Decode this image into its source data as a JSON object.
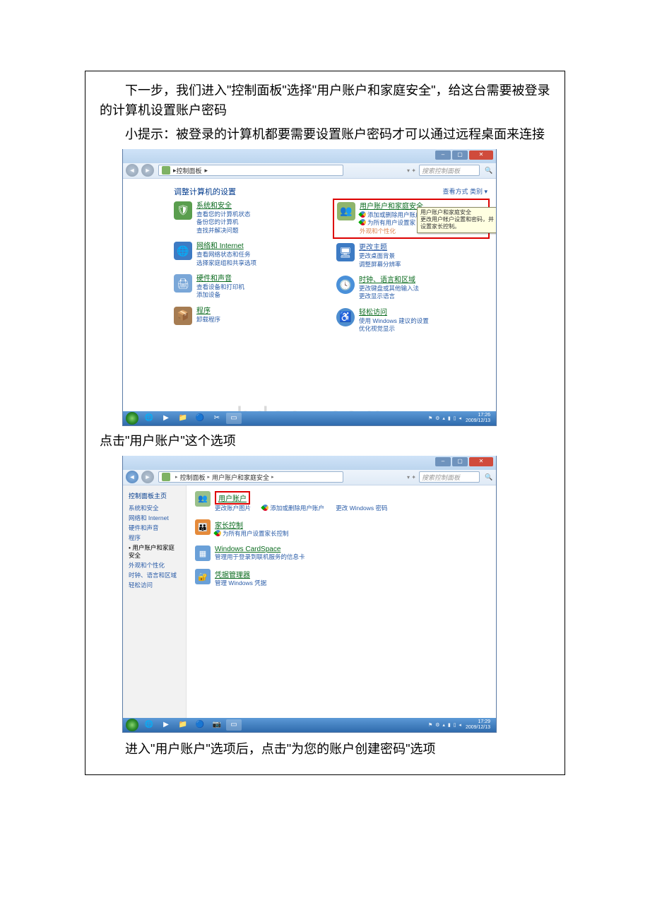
{
  "doc": {
    "p1": "下一步，我们进入\"控制面板\"选择\"用户账户和家庭安全\"，给这台需要被登录的计算机设置账户密码",
    "p2": "小提示：被登录的计算机都要需要设置账户密码才可以通过远程桌面来连接",
    "p3": "点击\"用户账户\"这个选项",
    "p4": "进入\"用户账户\"选项后，点击\"为您的账户创建密码\"选项"
  },
  "watermark": "www.bdocx.com",
  "shot1": {
    "breadcrumb": {
      "arrow": "▸",
      "item1": "控制面板",
      "arrow2": "▸"
    },
    "search_placeholder": "搜索控制面板",
    "search_icon": "🔍",
    "search_sep": "▾  ✦",
    "heading": "调整计算机的设置",
    "view_label": "查看方式  类别 ▾",
    "left": {
      "cat1_h": "系统和安全",
      "cat1_s1": "查看您的计算机状态",
      "cat1_s2": "备份您的计算机",
      "cat1_s3": "查找并解决问题",
      "cat2_h": "网络和 Internet",
      "cat2_s1": "查看网络状态和任务",
      "cat2_s2": "选择家庭组和共享选项",
      "cat3_h": "硬件和声音",
      "cat3_s1": "查看设备和打印机",
      "cat3_s2": "添加设备",
      "cat4_h": "程序",
      "cat4_s1": "卸载程序"
    },
    "right": {
      "cat1_h": "用户账户和家庭安全",
      "cat1_s1": "添加或删除用户账户",
      "cat1_s2": "为所有用户设置家",
      "cat1_sx": "外观和个性化",
      "tip_h": "用户账户和家庭安全",
      "tip_b": "更改用户帐户设置和密码，并设置家长控制。",
      "cat2_h": "更改主题",
      "cat2_s1": "更改桌面背景",
      "cat2_s2": "调整屏幕分辨率",
      "cat3_h": "时钟、语言和区域",
      "cat3_s1": "更改键盘或其他输入法",
      "cat3_s2": "更改显示语言",
      "cat4_h": "轻松访问",
      "cat4_s1": "使用 Windows 建议的设置",
      "cat4_s2": "优化视觉显示"
    },
    "tray_icons": "⚑ ⚙ ▴ ▮ ▯ ◂",
    "time": "17:26",
    "date": "2009/12/13"
  },
  "shot2": {
    "breadcrumb": {
      "item1": "控制面板",
      "item2": "用户账户和家庭安全",
      "arrow": "▸"
    },
    "search_placeholder": "搜索控制面板",
    "search_sep": "▾  ✦",
    "sidebar": {
      "h": "控制面板主页",
      "i1": "系统和安全",
      "i2": "网络和 Internet",
      "i3": "硬件和声音",
      "i4": "程序",
      "i5": "用户账户和家庭安全",
      "i6": "外观和个性化",
      "i7": "时钟、语言和区域",
      "i8": "轻松访问"
    },
    "main": {
      "e1_h": "用户账户",
      "e1_s1": "更改账户图片",
      "e1_s2": "添加或删除用户账户",
      "e1_s3": "更改 Windows 密码",
      "e2_h": "家长控制",
      "e2_s1": "为所有用户设置家长控制",
      "e3_h": "Windows CardSpace",
      "e3_s1": "管理用于登录到联机服务的信息卡",
      "e4_h": "凭据管理器",
      "e4_s1": "管理 Windows 凭据"
    },
    "tray_icons": "⚑ ⚙ ▴ ▮ ▯ ◂",
    "time": "17:29",
    "date": "2009/12/13"
  }
}
